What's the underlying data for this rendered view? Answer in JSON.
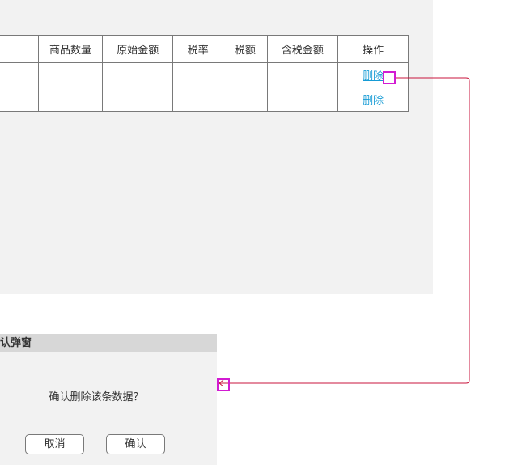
{
  "table": {
    "headers": [
      "",
      "商品数量",
      "原始金额",
      "税率",
      "税额",
      "含税金额",
      "操作"
    ],
    "rows": [
      {
        "action": "删除"
      },
      {
        "action": "删除"
      }
    ]
  },
  "dialog": {
    "title": "认弹窗",
    "message": "确认删除该条数据？",
    "cancel": "取消",
    "confirm": "确认"
  },
  "colors": {
    "connector": "#c8143c",
    "marker": "#d21bd2",
    "link": "#169bd5"
  }
}
